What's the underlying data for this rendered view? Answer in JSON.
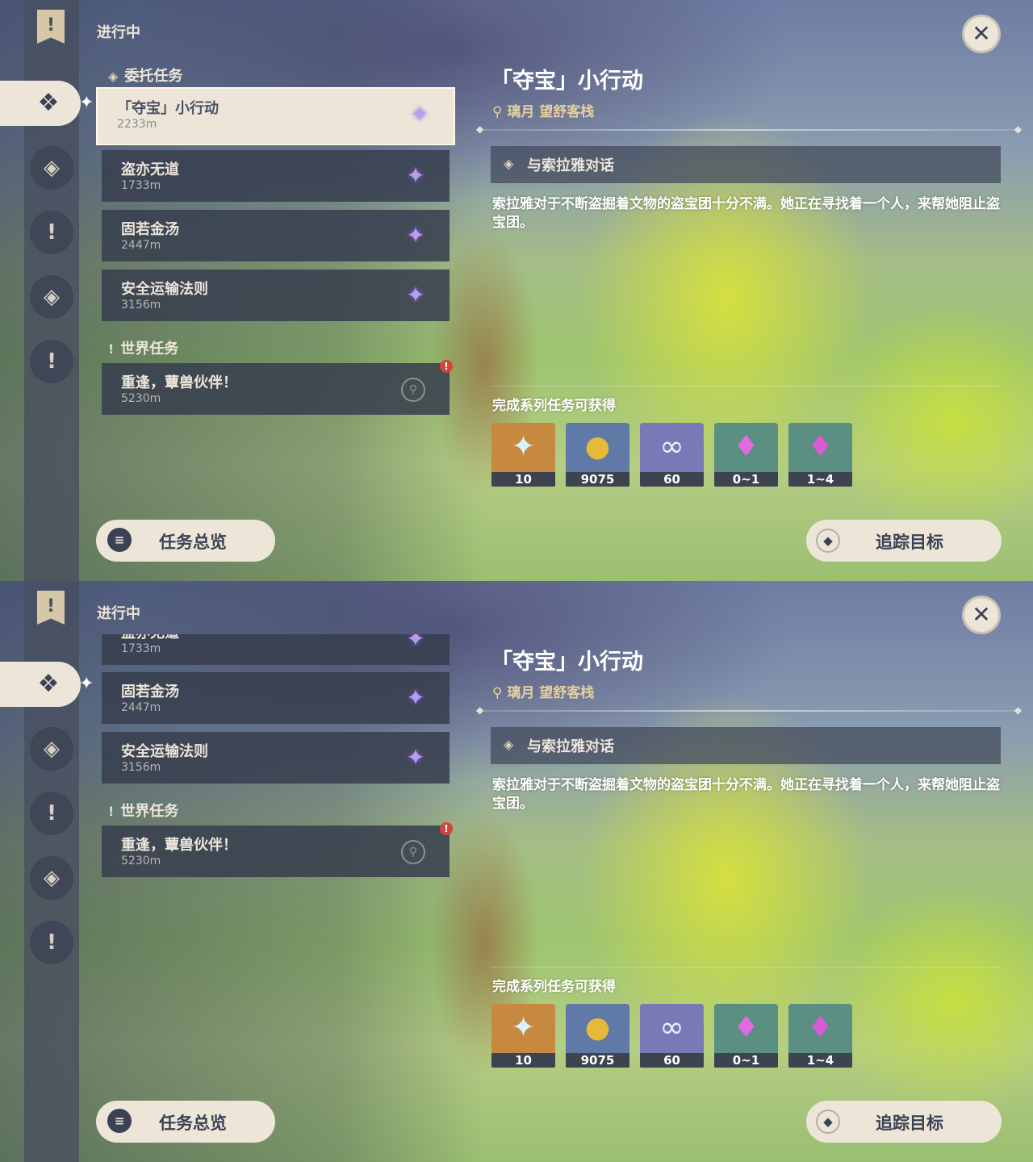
{
  "section_title": "进行中",
  "categories": {
    "commission": "委托任务",
    "world": "世界任务"
  },
  "quests": [
    {
      "name": "「夺宝」小行动",
      "distance": "2233m"
    },
    {
      "name": "盗亦无道",
      "distance": "1733m"
    },
    {
      "name": "固若金汤",
      "distance": "2447m"
    },
    {
      "name": "安全运输法则",
      "distance": "3156m"
    },
    {
      "name": "重逢，蕈兽伙伴！",
      "distance": "5230m"
    }
  ],
  "detail": {
    "title": "「夺宝」小行动",
    "location": "璃月  望舒客栈",
    "objective": "与索拉雅对话",
    "description": "索拉雅对于不断盗掘着文物的盗宝团十分不满。她正在寻找着一个人，来帮她阻止盗宝团。",
    "rewards_label": "完成系列任务可获得"
  },
  "rewards": [
    {
      "icon": "primogem-icon",
      "glyph": "✦",
      "count": "10",
      "bg": "#c7893f",
      "color": "#d9f1ff"
    },
    {
      "icon": "mora-icon",
      "glyph": "●",
      "count": "9075",
      "bg": "#5f7aa6",
      "color": "#e6b93a"
    },
    {
      "icon": "companionship-exp-icon",
      "glyph": "∞",
      "count": "60",
      "bg": "#7a79b7",
      "color": "#f0f0ff"
    },
    {
      "icon": "crystal-icon",
      "glyph": "♦",
      "count": "0~1",
      "bg": "#5a8f82",
      "color": "#e06be0"
    },
    {
      "icon": "crystal-cluster-icon",
      "glyph": "♦",
      "count": "1~4",
      "bg": "#5a8f82",
      "color": "#d85ad6"
    }
  ],
  "buttons": {
    "overview": "任务总览",
    "track": "追踪目标"
  },
  "icons": {
    "close": "✕",
    "flag": "!",
    "location_pin": "⚲",
    "objective_diamond": "◈",
    "quest_star": "✦",
    "alert": "!"
  },
  "colors": {
    "accent_cream": "#ece5d8",
    "card_dark": "#373e4e",
    "location_gold": "#e7cf9d",
    "alert_red": "#d2443c"
  }
}
